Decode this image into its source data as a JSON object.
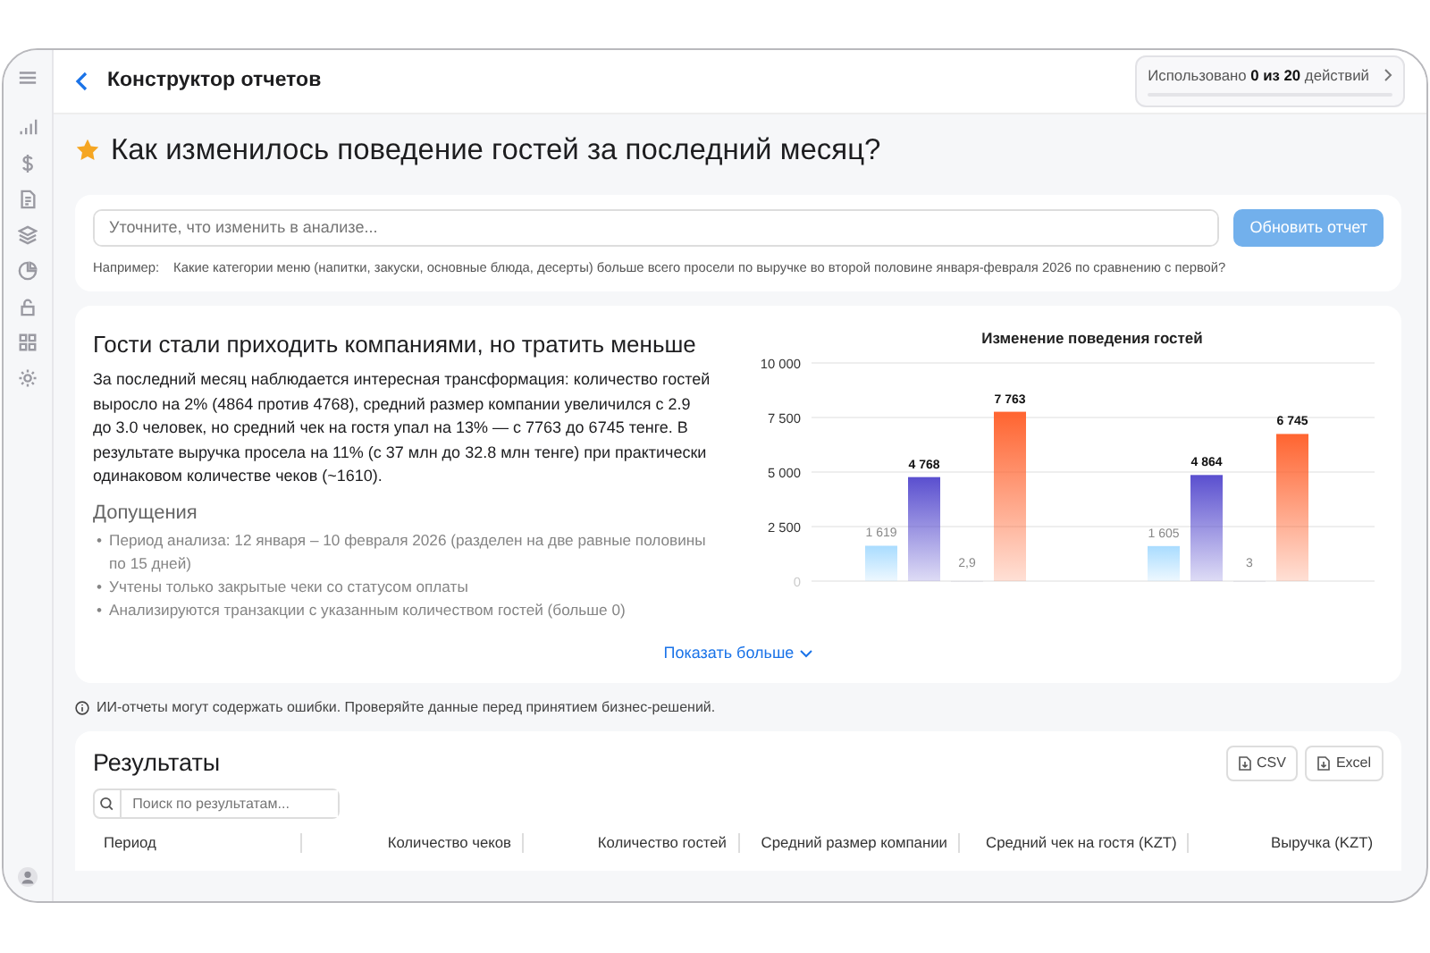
{
  "header": {
    "title": "Конструктор отчетов",
    "usage": {
      "prefix": "Использовано",
      "count": "0 из 20",
      "suffix": "действий",
      "level": 0
    }
  },
  "report": {
    "title": "Как изменилось поведение гостей за последний месяц?",
    "starred": true
  },
  "refine": {
    "placeholder": "Уточните, что изменить в анализе...",
    "button": "Обновить отчет",
    "button_disabled": true,
    "example_label": "Например:",
    "example": "Какие категории меню (напитки, закуски, основные блюда, десерты) больше всего просели по выручке во второй половине января-февраля 2026 по сравнению с первой?"
  },
  "insight": {
    "headline": "Гости стали приходить компаниями, но тратить меньше",
    "summary": "За последний месяц наблюдается интересная трансформация: количество гостей выросло на 2% (4864 против 4768), средний размер компании увеличился с 2.9 до 3.0 человек, но средний чек на гостя упал на 13% — с 7763 до 6745 тенге. В результате выручка просела на 11% (с 37 млн до 32.8 млн тенге) при практически одинаковом количестве чеков (~1610).",
    "assumptions_title": "Допущения",
    "bullet": "•",
    "assumptions": [
      "Период анализа: 12 января – 10 февраля 2026 (разделен на две равные половины по 15 дней)",
      "Учтены только закрытые чеки со статусом оплаты",
      "Анализируются транзакции с указанным количеством гостей (больше 0)"
    ],
    "show_more": "Показать больше",
    "chart_data": {
      "type": "bar",
      "title": "Изменение поведения гостей",
      "yticks": [
        {
          "value": 0,
          "label": "0"
        },
        {
          "value": 2500,
          "label": "2 500"
        },
        {
          "value": 5000,
          "label": "5 000"
        },
        {
          "value": 7500,
          "label": "7 500"
        },
        {
          "value": 10000,
          "label": "10 000"
        }
      ],
      "ylim": [
        0,
        10000
      ],
      "data_labels": true,
      "grid": true,
      "series": [
        {
          "color": "#a9dcff",
          "values": [
            1619,
            1605
          ],
          "value_labels": [
            "1 619",
            "1 605"
          ]
        },
        {
          "color": "#5a4fcf",
          "values": [
            4768,
            4864
          ],
          "value_labels": [
            "4 768",
            "4 864"
          ]
        },
        {
          "color": "#d6d6dc",
          "values": [
            2.9,
            3
          ],
          "value_labels": [
            "2,9",
            "3"
          ]
        },
        {
          "color": "#ff6430",
          "values": [
            7763,
            6745
          ],
          "value_labels": [
            "7 763",
            "6 745"
          ]
        }
      ]
    }
  },
  "disclaimer": "ИИ-отчеты могут содержать ошибки. Проверяйте данные перед принятием бизнес-решений.",
  "results": {
    "title": "Результаты",
    "exports": [
      "CSV",
      "Excel"
    ],
    "search_placeholder": "Поиск по результатам...",
    "columns": [
      "Период",
      "Количество чеков",
      "Количество гостей",
      "Средний размер компании",
      "Средний чек на гостя (KZT)",
      "Выручка (KZT)"
    ]
  }
}
